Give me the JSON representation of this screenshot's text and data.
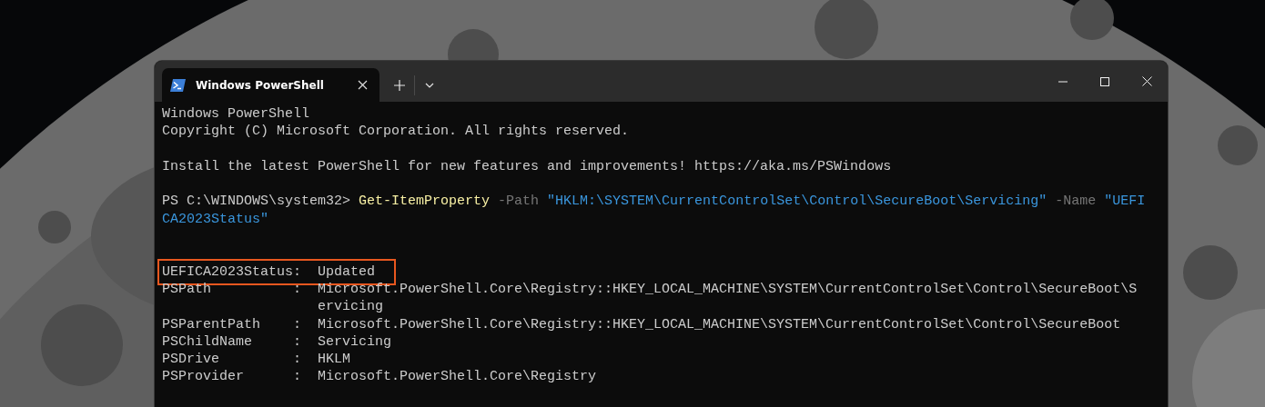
{
  "tab": {
    "title": "Windows PowerShell",
    "selected": true
  },
  "terminal": {
    "lines": [
      {
        "kind": "text",
        "segments": [
          {
            "kind": "plain",
            "text": "Windows PowerShell"
          }
        ]
      },
      {
        "kind": "text",
        "segments": [
          {
            "kind": "plain",
            "text": "Copyright (C) Microsoft Corporation. All rights reserved."
          }
        ]
      },
      {
        "kind": "blank"
      },
      {
        "kind": "text",
        "segments": [
          {
            "kind": "plain",
            "text": "Install the latest PowerShell for new features and improvements! https://aka.ms/PSWindows"
          }
        ]
      },
      {
        "kind": "blank"
      },
      {
        "kind": "text",
        "segments": [
          {
            "kind": "plain",
            "text": "PS C:\\WINDOWS\\system32> "
          },
          {
            "kind": "command",
            "text": "Get-ItemProperty"
          },
          {
            "kind": "parameter",
            "text": " -Path "
          },
          {
            "kind": "string",
            "text": "\"HKLM:\\SYSTEM\\CurrentControlSet\\Control\\SecureBoot\\Servicing\""
          },
          {
            "kind": "parameter",
            "text": " -Name "
          },
          {
            "kind": "string",
            "text": "\"UEFI"
          }
        ]
      },
      {
        "kind": "text",
        "segments": [
          {
            "kind": "string",
            "text": "CA2023Status\""
          }
        ]
      },
      {
        "kind": "blank"
      },
      {
        "kind": "blank"
      },
      {
        "kind": "property",
        "name": "UEFICA2023Status",
        "separator": ":",
        "values": [
          "Updated"
        ],
        "highlighted": true
      },
      {
        "kind": "property",
        "name": "PSPath",
        "separator": ":",
        "values": [
          "Microsoft.PowerShell.Core\\Registry::HKEY_LOCAL_MACHINE\\SYSTEM\\CurrentControlSet\\Control\\SecureBoot\\S",
          "ervicing"
        ],
        "highlighted": false
      },
      {
        "kind": "property",
        "name": "PSParentPath",
        "separator": ":",
        "values": [
          "Microsoft.PowerShell.Core\\Registry::HKEY_LOCAL_MACHINE\\SYSTEM\\CurrentControlSet\\Control\\SecureBoot"
        ],
        "highlighted": false
      },
      {
        "kind": "property",
        "name": "PSChildName",
        "separator": ":",
        "values": [
          "Servicing"
        ],
        "highlighted": false
      },
      {
        "kind": "property",
        "name": "PSDrive",
        "separator": ":",
        "values": [
          "HKLM"
        ],
        "highlighted": false
      },
      {
        "kind": "property",
        "name": "PSProvider",
        "separator": ":",
        "values": [
          "Microsoft.PowerShell.Core\\Registry"
        ],
        "highlighted": false
      }
    ]
  }
}
